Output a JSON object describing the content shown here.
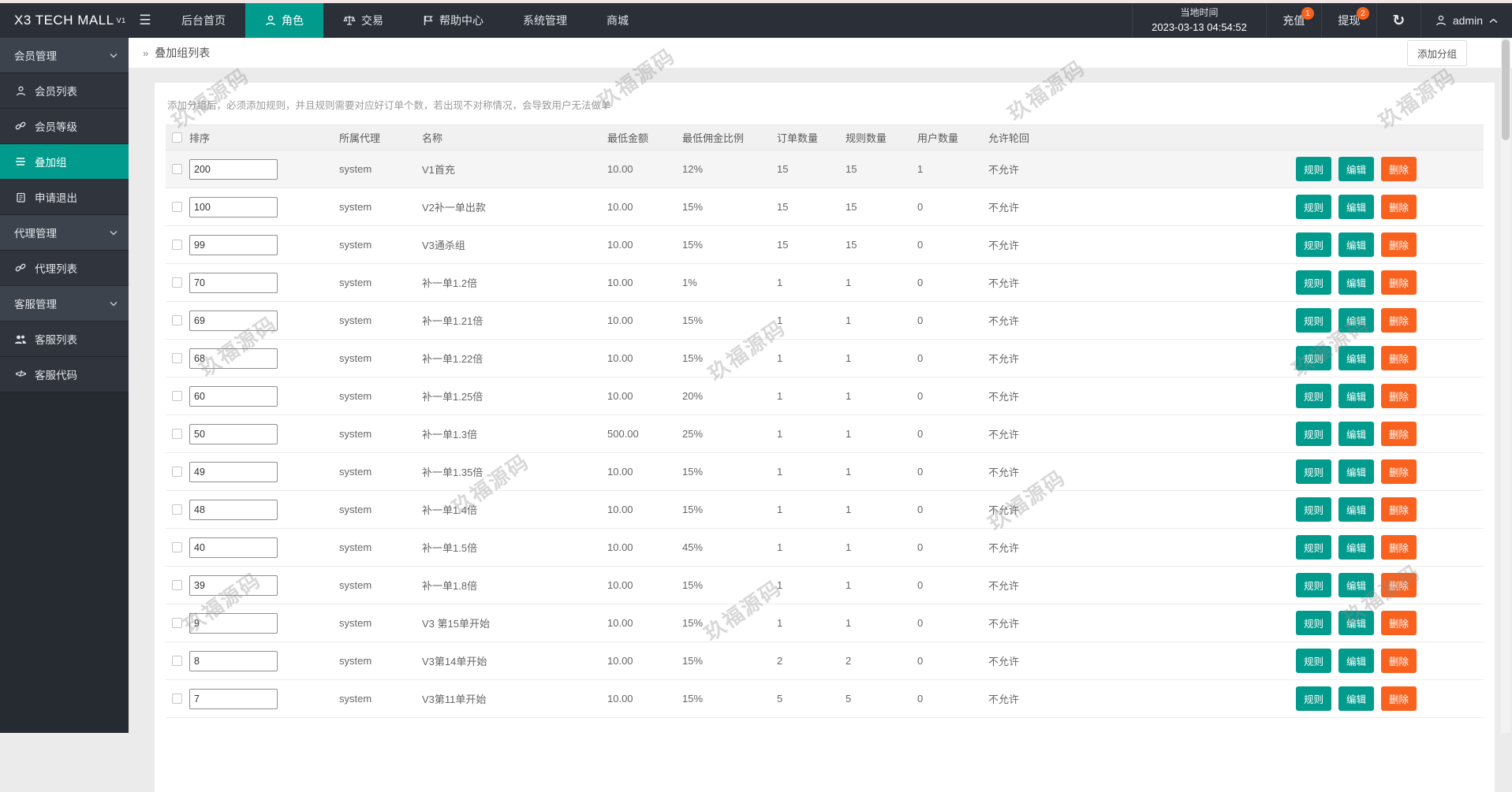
{
  "topbar": {
    "logo": "X3 TECH MALL",
    "logo_sup": "V1",
    "nav": [
      {
        "label": "后台首页"
      },
      {
        "label": "角色",
        "icon": "person",
        "active": true
      },
      {
        "label": "交易",
        "icon": "scales"
      },
      {
        "label": "帮助中心",
        "icon": "flag"
      },
      {
        "label": "系统管理"
      },
      {
        "label": "商城"
      }
    ],
    "time": {
      "label": "当地时间",
      "value": "2023-03-13 04:54:52"
    },
    "recharge": {
      "label": "充值",
      "badge": "1"
    },
    "withdraw": {
      "label": "提现",
      "badge": "2"
    },
    "user": {
      "name": "admin"
    }
  },
  "sidebar": {
    "items": [
      {
        "label": "会员管理",
        "type": "group"
      },
      {
        "label": "会员列表",
        "type": "sub",
        "icon": "person"
      },
      {
        "label": "会员等级",
        "type": "sub",
        "icon": "link"
      },
      {
        "label": "叠加组",
        "type": "sub",
        "icon": "bars",
        "active": true
      },
      {
        "label": "申请退出",
        "type": "sub",
        "icon": "clipboard"
      },
      {
        "label": "代理管理",
        "type": "group"
      },
      {
        "label": "代理列表",
        "type": "sub",
        "icon": "link"
      },
      {
        "label": "客服管理",
        "type": "group"
      },
      {
        "label": "客服列表",
        "type": "sub",
        "icon": "people"
      },
      {
        "label": "客服代码",
        "type": "sub",
        "icon": "code"
      }
    ]
  },
  "breadcrumb": {
    "title": "叠加组列表"
  },
  "add_group_button": "添加分组",
  "notice": "添加分组后，必须添加规则，并且规则需要对应好订单个数，若出现不对称情况，会导致用户无法做单",
  "table": {
    "headers": [
      "排序",
      "所属代理",
      "名称",
      "最低金额",
      "最低佣金比例",
      "订单数量",
      "规则数量",
      "用户数量",
      "允许轮回"
    ],
    "action_labels": {
      "rule": "规则",
      "edit": "编辑",
      "delete": "删除"
    },
    "rows": [
      {
        "sort": "200",
        "agent": "system",
        "name": "V1首充",
        "min_amount": "10.00",
        "min_commission": "12%",
        "orders": "15",
        "rules": "15",
        "users": "1",
        "loop": "不允许"
      },
      {
        "sort": "100",
        "agent": "system",
        "name": "V2补一单出款",
        "min_amount": "10.00",
        "min_commission": "15%",
        "orders": "15",
        "rules": "15",
        "users": "0",
        "loop": "不允许"
      },
      {
        "sort": "99",
        "agent": "system",
        "name": "V3通杀组",
        "min_amount": "10.00",
        "min_commission": "15%",
        "orders": "15",
        "rules": "15",
        "users": "0",
        "loop": "不允许"
      },
      {
        "sort": "70",
        "agent": "system",
        "name": "补一单1.2倍",
        "min_amount": "10.00",
        "min_commission": "1%",
        "orders": "1",
        "rules": "1",
        "users": "0",
        "loop": "不允许"
      },
      {
        "sort": "69",
        "agent": "system",
        "name": "补一单1.21倍",
        "min_amount": "10.00",
        "min_commission": "15%",
        "orders": "1",
        "rules": "1",
        "users": "0",
        "loop": "不允许"
      },
      {
        "sort": "68",
        "agent": "system",
        "name": "补一单1.22倍",
        "min_amount": "10.00",
        "min_commission": "15%",
        "orders": "1",
        "rules": "1",
        "users": "0",
        "loop": "不允许"
      },
      {
        "sort": "60",
        "agent": "system",
        "name": "补一单1.25倍",
        "min_amount": "10.00",
        "min_commission": "20%",
        "orders": "1",
        "rules": "1",
        "users": "0",
        "loop": "不允许"
      },
      {
        "sort": "50",
        "agent": "system",
        "name": "补一单1.3倍",
        "min_amount": "500.00",
        "min_commission": "25%",
        "orders": "1",
        "rules": "1",
        "users": "0",
        "loop": "不允许"
      },
      {
        "sort": "49",
        "agent": "system",
        "name": "补一单1.35倍",
        "min_amount": "10.00",
        "min_commission": "15%",
        "orders": "1",
        "rules": "1",
        "users": "0",
        "loop": "不允许"
      },
      {
        "sort": "48",
        "agent": "system",
        "name": "补一单1.4倍",
        "min_amount": "10.00",
        "min_commission": "15%",
        "orders": "1",
        "rules": "1",
        "users": "0",
        "loop": "不允许"
      },
      {
        "sort": "40",
        "agent": "system",
        "name": "补一单1.5倍",
        "min_amount": "10.00",
        "min_commission": "45%",
        "orders": "1",
        "rules": "1",
        "users": "0",
        "loop": "不允许"
      },
      {
        "sort": "39",
        "agent": "system",
        "name": "补一单1.8倍",
        "min_amount": "10.00",
        "min_commission": "15%",
        "orders": "1",
        "rules": "1",
        "users": "0",
        "loop": "不允许"
      },
      {
        "sort": "9",
        "agent": "system",
        "name": "V3 第15单开始",
        "min_amount": "10.00",
        "min_commission": "15%",
        "orders": "1",
        "rules": "1",
        "users": "0",
        "loop": "不允许"
      },
      {
        "sort": "8",
        "agent": "system",
        "name": "V3第14单开始",
        "min_amount": "10.00",
        "min_commission": "15%",
        "orders": "2",
        "rules": "2",
        "users": "0",
        "loop": "不允许"
      },
      {
        "sort": "7",
        "agent": "system",
        "name": "V3第11单开始",
        "min_amount": "10.00",
        "min_commission": "15%",
        "orders": "5",
        "rules": "5",
        "users": "0",
        "loop": "不允许"
      }
    ]
  },
  "watermark": "玖福源码",
  "colors": {
    "accent_teal": "#009b8d",
    "accent_orange": "#f9611e",
    "topbar_bg": "#2b2f38",
    "sidebar_bg": "#2f343d"
  }
}
